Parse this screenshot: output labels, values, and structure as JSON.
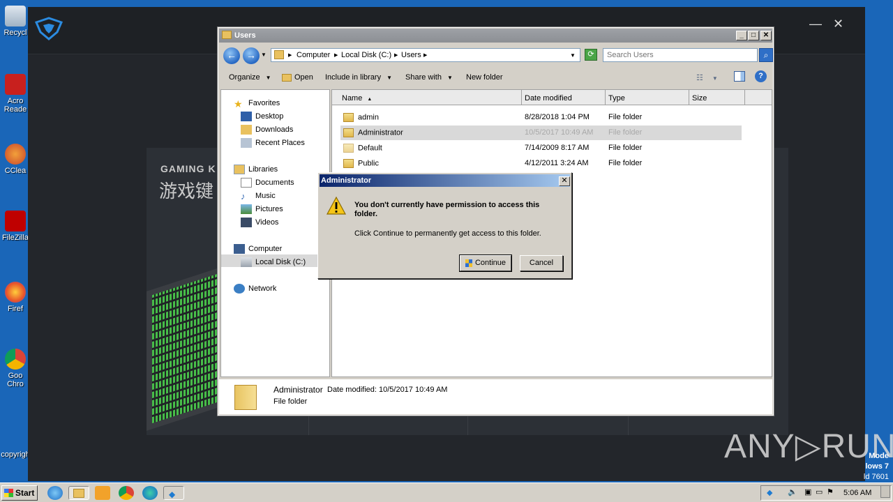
{
  "desktop": {
    "icons": [
      {
        "label": "Recycl",
        "icon": "recycle-bin-icon"
      },
      {
        "label": "Acro\nReade",
        "icon": "acrobat-reader-icon"
      },
      {
        "label": "CClea",
        "icon": "ccleaner-icon"
      },
      {
        "label": "FileZilla",
        "icon": "filezilla-icon"
      },
      {
        "label": "Firef",
        "icon": "firefox-icon"
      },
      {
        "label": "Goo\nChro",
        "icon": "chrome-icon"
      },
      {
        "label": "copyrigh",
        "icon": ""
      }
    ],
    "corner_lines": [
      "Mode",
      "lows 7",
      "ld 7601"
    ]
  },
  "app": {
    "heading": "GAMING K",
    "heading_cn": "游戏键",
    "close_glyph": "✕",
    "min_glyph": "—"
  },
  "explorer": {
    "title": "Users",
    "breadcrumb": [
      "Computer",
      "Local Disk (C:)",
      "Users"
    ],
    "search_placeholder": "Search Users",
    "toolbar": {
      "organize": "Organize",
      "open": "Open",
      "include": "Include in library",
      "share": "Share with",
      "new_folder": "New folder"
    },
    "nav": {
      "favorites": "Favorites",
      "desktop": "Desktop",
      "downloads": "Downloads",
      "recent": "Recent Places",
      "libraries": "Libraries",
      "documents": "Documents",
      "music": "Music",
      "pictures": "Pictures",
      "videos": "Videos",
      "computer": "Computer",
      "local_disk": "Local Disk (C:)",
      "network": "Network"
    },
    "columns": {
      "name": "Name",
      "date": "Date modified",
      "type": "Type",
      "size": "Size"
    },
    "files": [
      {
        "name": "admin",
        "date": "8/28/2018 1:04 PM",
        "type": "File folder"
      },
      {
        "name": "Administrator",
        "date": "10/5/2017 10:49 AM",
        "type": "File folder"
      },
      {
        "name": "Default",
        "date": "7/14/2009 8:17 AM",
        "type": "File folder"
      },
      {
        "name": "Public",
        "date": "4/12/2011 3:24 AM",
        "type": "File folder"
      }
    ],
    "details": {
      "name": "Administrator",
      "modified": "Date modified: 10/5/2017 10:49 AM",
      "type": "File folder"
    }
  },
  "dialog": {
    "title": "Administrator",
    "message": "You don't currently have permission to access this folder.",
    "sub": "Click Continue to permanently get access to this folder.",
    "continue": "Continue",
    "cancel": "Cancel"
  },
  "taskbar": {
    "start": "Start",
    "clock": "5:06 AM"
  },
  "watermark": "ANY▷RUN",
  "colors": {
    "dialog_title": "#0a246a",
    "selection": "#d9d9d9",
    "desktop": "#1a66b8"
  }
}
